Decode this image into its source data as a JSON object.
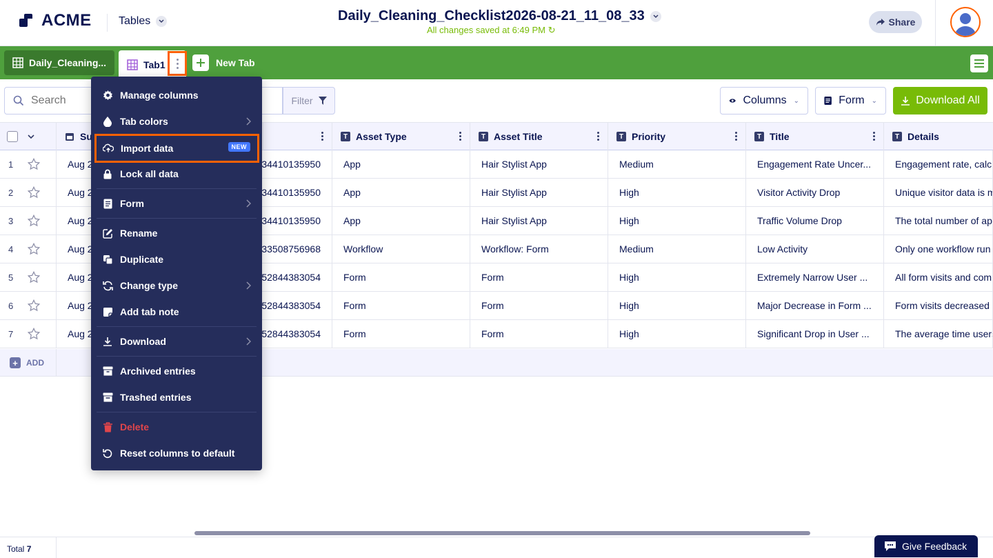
{
  "header": {
    "brand": "ACME",
    "tables_label": "Tables",
    "doc_title": "Daily_Cleaning_Checklist2026-08-21_11_08_33",
    "saved_status": "All changes saved at 6:49 PM",
    "share_label": "Share"
  },
  "tabs": {
    "table_tab": "Daily_Cleaning...",
    "active_tab": "Tab1",
    "new_tab": "New Tab"
  },
  "toolbar": {
    "search_placeholder": "Search",
    "filter_label": "Filter",
    "columns_label": "Columns",
    "form_label": "Form",
    "download_all_label": "Download All"
  },
  "columns": [
    "Su",
    "Asset Type",
    "Asset Title",
    "Priority",
    "Title",
    "Details"
  ],
  "rows": [
    {
      "num": "1",
      "date": "Aug 2",
      "id": "34410135950",
      "asset_type": "App",
      "asset_title": "Hair Stylist App",
      "priority": "Medium",
      "title": "Engagement Rate Uncer...",
      "details": "Engagement rate, calcu"
    },
    {
      "num": "2",
      "date": "Aug 2",
      "id": "34410135950",
      "asset_type": "App",
      "asset_title": "Hair Stylist App",
      "priority": "High",
      "title": "Visitor Activity Drop",
      "details": "Unique visitor data is m"
    },
    {
      "num": "3",
      "date": "Aug 2",
      "id": "34410135950",
      "asset_type": "App",
      "asset_title": "Hair Stylist App",
      "priority": "High",
      "title": "Traffic Volume Drop",
      "details": "The total number of ap"
    },
    {
      "num": "4",
      "date": "Aug 2",
      "id": "33508756968",
      "asset_type": "Workflow",
      "asset_title": "Workflow: Form",
      "priority": "Medium",
      "title": "Low Activity",
      "details": "Only one workflow run"
    },
    {
      "num": "5",
      "date": "Aug 2",
      "id": "52844383054",
      "asset_type": "Form",
      "asset_title": "Form",
      "priority": "High",
      "title": "Extremely Narrow User ...",
      "details": "All form visits and com"
    },
    {
      "num": "6",
      "date": "Aug 2",
      "id": "52844383054",
      "asset_type": "Form",
      "asset_title": "Form",
      "priority": "High",
      "title": "Major Decrease in Form ...",
      "details": "Form visits decreased f"
    },
    {
      "num": "7",
      "date": "Aug 2",
      "id": "52844383054",
      "asset_type": "Form",
      "asset_title": "Form",
      "priority": "High",
      "title": "Significant Drop in User ...",
      "details": "The average time users"
    }
  ],
  "add_label": "ADD",
  "footer": {
    "total_label": "Total",
    "total_count": "7",
    "feedback_label": "Give Feedback"
  },
  "menu": {
    "manage_columns": "Manage columns",
    "tab_colors": "Tab colors",
    "import_data": "Import data",
    "new_badge": "NEW",
    "lock_all_data": "Lock all data",
    "form": "Form",
    "rename": "Rename",
    "duplicate": "Duplicate",
    "change_type": "Change type",
    "add_tab_note": "Add tab note",
    "download": "Download",
    "archived_entries": "Archived entries",
    "trashed_entries": "Trashed entries",
    "delete": "Delete",
    "reset_columns": "Reset columns to default"
  },
  "colors": {
    "accent_orange": "#ff6100",
    "tab_green": "#4fa03d",
    "download_green": "#78bb07",
    "menu_bg": "#252d5b",
    "navy": "#0a1551"
  }
}
